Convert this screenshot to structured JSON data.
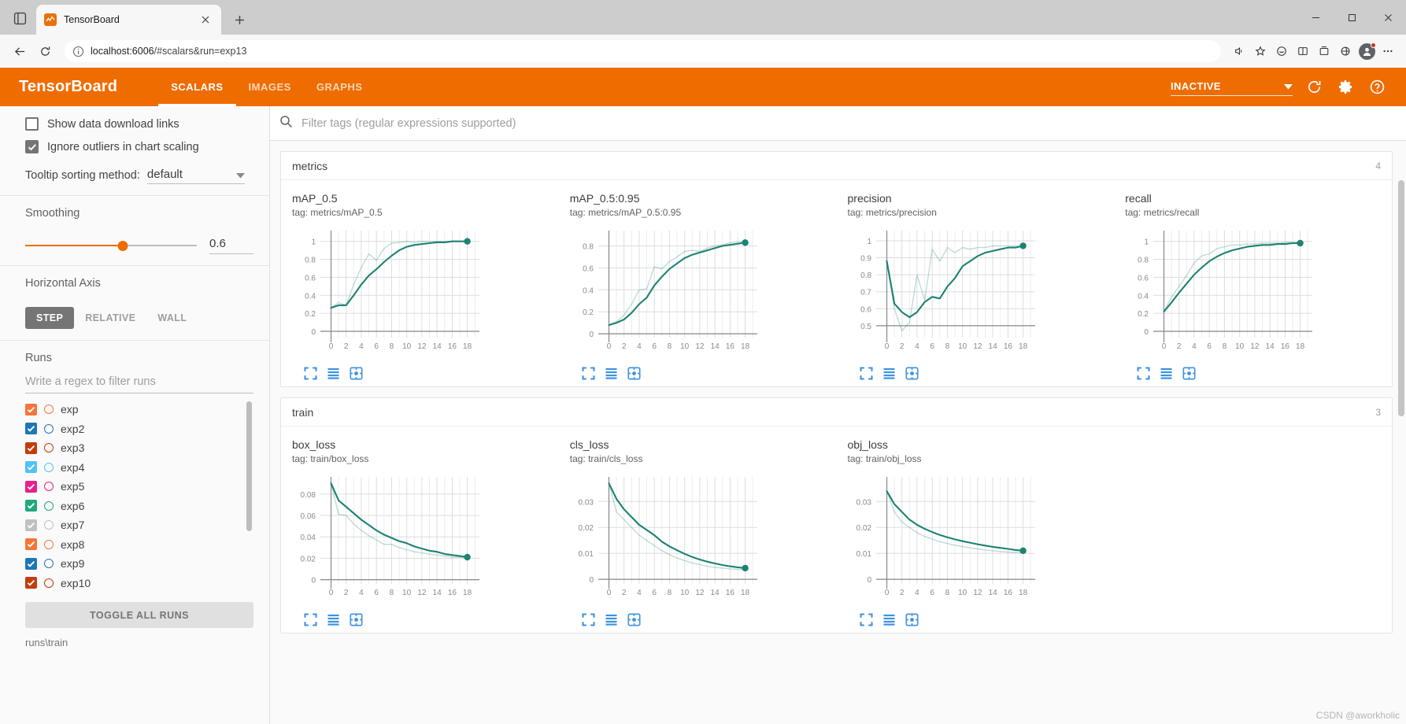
{
  "browser": {
    "tab": {
      "title": "TensorBoard",
      "favicon_icon": "tensorboard-favicon",
      "close_icon": "close-icon"
    },
    "tab_list_icon": "tab-list-icon",
    "new_tab_icon": "plus-icon",
    "window_controls": [
      {
        "name": "minimize-button",
        "icon": "minimize-icon"
      },
      {
        "name": "maximize-button",
        "icon": "maximize-icon"
      },
      {
        "name": "close-window-button",
        "icon": "close-icon"
      }
    ],
    "nav": {
      "back_icon": "back-arrow-icon",
      "reload_icon": "reload-icon",
      "info_icon": "info-circle-icon",
      "url_host": "localhost:6006",
      "url_path": "/#scalars&run=exp13",
      "read_aloud_icon": "read-aloud-icon",
      "favorite_icon": "star-icon",
      "copilot_icon": "copilot-icon",
      "split_icon": "split-screen-icon",
      "collections_icon": "collections-icon",
      "browser_essentials_icon": "browser-essentials-icon",
      "settings_icon": "more-options-icon",
      "profile_icon": "profile-avatar"
    }
  },
  "tensorboard": {
    "logo": "TensorBoard",
    "tabs": [
      {
        "label": "SCALARS",
        "active": true
      },
      {
        "label": "IMAGES",
        "active": false
      },
      {
        "label": "GRAPHS",
        "active": false
      }
    ],
    "status_select": {
      "value": "INACTIVE",
      "caret_icon": "chevron-down-icon"
    },
    "header_icons": [
      {
        "name": "reload-button",
        "icon": "reload-icon"
      },
      {
        "name": "settings-button",
        "icon": "gear-icon"
      },
      {
        "name": "help-button",
        "icon": "help-circle-icon"
      }
    ]
  },
  "sidebar": {
    "checkboxes": [
      {
        "label": "Show data download links",
        "checked": false,
        "name": "show-data-download-links-checkbox"
      },
      {
        "label": "Ignore outliers in chart scaling",
        "checked": true,
        "name": "ignore-outliers-checkbox"
      }
    ],
    "tooltip_sorting": {
      "label": "Tooltip sorting method:",
      "value": "default"
    },
    "smoothing": {
      "title": "Smoothing",
      "value": "0.6",
      "percent": 57
    },
    "horizontal_axis": {
      "title": "Horizontal Axis",
      "options": [
        {
          "label": "STEP",
          "active": true
        },
        {
          "label": "RELATIVE",
          "active": false
        },
        {
          "label": "WALL",
          "active": false
        }
      ]
    },
    "runs": {
      "title": "Runs",
      "filter_placeholder": "Write a regex to filter runs",
      "items": [
        {
          "label": "exp",
          "color": "#f4763b",
          "checked": true
        },
        {
          "label": "exp2",
          "color": "#1f77b4",
          "checked": true
        },
        {
          "label": "exp3",
          "color": "#c43c0c",
          "checked": true
        },
        {
          "label": "exp4",
          "color": "#4fc3f7",
          "checked": true
        },
        {
          "label": "exp5",
          "color": "#e91e8c",
          "checked": true
        },
        {
          "label": "exp6",
          "color": "#1fa97f",
          "checked": true
        },
        {
          "label": "exp7",
          "color": "#c0c0c0",
          "checked": true
        },
        {
          "label": "exp8",
          "color": "#f4763b",
          "checked": true
        },
        {
          "label": "exp9",
          "color": "#1f77b4",
          "checked": true
        },
        {
          "label": "exp10",
          "color": "#c43c0c",
          "checked": true
        }
      ],
      "toggle_all_label": "TOGGLE ALL RUNS",
      "path": "runs\\train"
    }
  },
  "main": {
    "filter_placeholder": "Filter tags (regular expressions supported)",
    "search_icon": "search-icon",
    "chart_tool_icons": [
      "fullscreen-icon",
      "data-table-icon",
      "reset-axis-icon"
    ],
    "groups": [
      {
        "title": "metrics",
        "count": "4"
      },
      {
        "title": "train",
        "count": "3"
      }
    ],
    "watermark": "CSDN @aworkholic"
  },
  "chart_data": [
    {
      "type": "line",
      "title": "mAP_0.5",
      "tag": "tag: metrics/mAP_0.5",
      "group": "metrics",
      "xlabel": "",
      "ylabel": "",
      "xticks": [
        0,
        2,
        4,
        6,
        8,
        10,
        12,
        14,
        16,
        18
      ],
      "yticks": [
        0,
        0.2,
        0.4,
        0.6,
        0.8,
        1
      ],
      "xlim": [
        -1.4,
        19.6
      ],
      "ylim": [
        -0.07,
        1.12
      ],
      "grid": true,
      "legend": "none",
      "x": [
        0,
        1,
        2,
        3,
        4,
        5,
        6,
        7,
        8,
        9,
        10,
        11,
        12,
        13,
        14,
        15,
        16,
        17,
        18
      ],
      "series": [
        {
          "name": "raw",
          "opacity": 0.28,
          "values": [
            0.26,
            0.32,
            0.29,
            0.52,
            0.71,
            0.86,
            0.79,
            0.92,
            0.98,
            0.99,
            1.0,
            0.99,
            1.0,
            1.0,
            1.0,
            1.0,
            1.0,
            1.0,
            1.0
          ]
        },
        {
          "name": "smoothed",
          "opacity": 1.0,
          "endpoint": true,
          "values": [
            0.26,
            0.29,
            0.29,
            0.4,
            0.52,
            0.62,
            0.69,
            0.77,
            0.84,
            0.9,
            0.94,
            0.96,
            0.97,
            0.98,
            0.99,
            0.99,
            1.0,
            1.0,
            1.0
          ]
        }
      ]
    },
    {
      "type": "line",
      "title": "mAP_0.5:0.95",
      "tag": "tag: metrics/mAP_0.5:0.95",
      "group": "metrics",
      "xlabel": "",
      "ylabel": "",
      "xticks": [
        0,
        2,
        4,
        6,
        8,
        10,
        12,
        14,
        16,
        18
      ],
      "yticks": [
        0,
        0.2,
        0.4,
        0.6,
        0.8
      ],
      "xlim": [
        -1.4,
        19.6
      ],
      "ylim": [
        -0.035,
        0.94
      ],
      "grid": true,
      "legend": "none",
      "x": [
        0,
        1,
        2,
        3,
        4,
        5,
        6,
        7,
        8,
        9,
        10,
        11,
        12,
        13,
        14,
        15,
        16,
        17,
        18
      ],
      "series": [
        {
          "name": "raw",
          "opacity": 0.28,
          "values": [
            0.08,
            0.11,
            0.17,
            0.27,
            0.4,
            0.41,
            0.61,
            0.59,
            0.66,
            0.7,
            0.75,
            0.76,
            0.75,
            0.78,
            0.8,
            0.81,
            0.83,
            0.84,
            0.84
          ]
        },
        {
          "name": "smoothed",
          "opacity": 1.0,
          "endpoint": true,
          "values": [
            0.08,
            0.1,
            0.13,
            0.19,
            0.27,
            0.33,
            0.44,
            0.52,
            0.59,
            0.64,
            0.69,
            0.72,
            0.74,
            0.76,
            0.78,
            0.8,
            0.81,
            0.82,
            0.83
          ]
        }
      ]
    },
    {
      "type": "line",
      "title": "precision",
      "tag": "tag: metrics/precision",
      "group": "metrics",
      "xlabel": "",
      "ylabel": "",
      "xticks": [
        0,
        2,
        4,
        6,
        8,
        10,
        12,
        14,
        16,
        18
      ],
      "yticks": [
        0.5,
        0.6,
        0.7,
        0.8,
        0.9,
        1
      ],
      "xlim": [
        -1.4,
        19.6
      ],
      "ylim": [
        0.43,
        1.06
      ],
      "grid": true,
      "legend": "none",
      "x": [
        0,
        1,
        2,
        3,
        4,
        5,
        6,
        7,
        8,
        9,
        10,
        11,
        12,
        13,
        14,
        15,
        16,
        17,
        18
      ],
      "series": [
        {
          "name": "raw",
          "opacity": 0.28,
          "values": [
            0.88,
            0.6,
            0.47,
            0.52,
            0.8,
            0.65,
            0.95,
            0.88,
            0.96,
            0.93,
            0.96,
            0.95,
            0.96,
            0.96,
            0.97,
            0.97,
            0.97,
            0.97,
            0.97
          ]
        },
        {
          "name": "smoothed",
          "opacity": 1.0,
          "endpoint": true,
          "values": [
            0.88,
            0.63,
            0.58,
            0.55,
            0.58,
            0.64,
            0.67,
            0.66,
            0.73,
            0.78,
            0.85,
            0.88,
            0.91,
            0.93,
            0.94,
            0.95,
            0.96,
            0.96,
            0.97
          ]
        }
      ]
    },
    {
      "type": "line",
      "title": "recall",
      "tag": "tag: metrics/recall",
      "group": "metrics",
      "xlabel": "",
      "ylabel": "",
      "xticks": [
        0,
        2,
        4,
        6,
        8,
        10,
        12,
        14,
        16,
        18
      ],
      "yticks": [
        0,
        0.2,
        0.4,
        0.6,
        0.8,
        1
      ],
      "xlim": [
        -1.4,
        19.6
      ],
      "ylim": [
        -0.07,
        1.12
      ],
      "grid": true,
      "legend": "none",
      "x": [
        0,
        1,
        2,
        3,
        4,
        5,
        6,
        7,
        8,
        9,
        10,
        11,
        12,
        13,
        14,
        15,
        16,
        17,
        18
      ],
      "series": [
        {
          "name": "raw",
          "opacity": 0.28,
          "values": [
            0.22,
            0.38,
            0.5,
            0.62,
            0.76,
            0.84,
            0.86,
            0.92,
            0.94,
            0.96,
            0.96,
            0.97,
            0.97,
            0.98,
            0.98,
            0.98,
            0.99,
            0.99,
            0.99
          ]
        },
        {
          "name": "smoothed",
          "opacity": 1.0,
          "endpoint": true,
          "values": [
            0.22,
            0.32,
            0.43,
            0.53,
            0.63,
            0.71,
            0.78,
            0.83,
            0.87,
            0.9,
            0.92,
            0.94,
            0.95,
            0.96,
            0.96,
            0.97,
            0.97,
            0.98,
            0.98
          ]
        }
      ]
    },
    {
      "type": "line",
      "title": "box_loss",
      "tag": "tag: train/box_loss",
      "group": "train",
      "xlabel": "",
      "ylabel": "",
      "xticks": [
        0,
        2,
        4,
        6,
        8,
        10,
        12,
        14,
        16,
        18
      ],
      "yticks": [
        0,
        0.02,
        0.04,
        0.06,
        0.08
      ],
      "xlim": [
        -1.4,
        19.6
      ],
      "ylim": [
        -0.004,
        0.096
      ],
      "grid": true,
      "legend": "none",
      "x": [
        0,
        1,
        2,
        3,
        4,
        5,
        6,
        7,
        8,
        9,
        10,
        11,
        12,
        13,
        14,
        15,
        16,
        17,
        18
      ],
      "series": [
        {
          "name": "raw",
          "opacity": 0.28,
          "values": [
            0.09,
            0.061,
            0.06,
            0.052,
            0.046,
            0.041,
            0.037,
            0.033,
            0.033,
            0.03,
            0.028,
            0.026,
            0.025,
            0.024,
            0.023,
            0.022,
            0.021,
            0.021,
            0.02
          ]
        },
        {
          "name": "smoothed",
          "opacity": 1.0,
          "endpoint": true,
          "values": [
            0.09,
            0.074,
            0.068,
            0.062,
            0.056,
            0.051,
            0.046,
            0.042,
            0.039,
            0.036,
            0.034,
            0.031,
            0.029,
            0.027,
            0.026,
            0.024,
            0.023,
            0.022,
            0.021
          ]
        }
      ]
    },
    {
      "type": "line",
      "title": "cls_loss",
      "tag": "tag: train/cls_loss",
      "group": "train",
      "xlabel": "",
      "ylabel": "",
      "xticks": [
        0,
        2,
        4,
        6,
        8,
        10,
        12,
        14,
        16,
        18
      ],
      "yticks": [
        0,
        0.01,
        0.02,
        0.03
      ],
      "xlim": [
        -1.4,
        19.6
      ],
      "ylim": [
        -0.0018,
        0.0395
      ],
      "grid": true,
      "legend": "none",
      "x": [
        0,
        1,
        2,
        3,
        4,
        5,
        6,
        7,
        8,
        9,
        10,
        11,
        12,
        13,
        14,
        15,
        16,
        17,
        18
      ],
      "series": [
        {
          "name": "raw",
          "opacity": 0.28,
          "values": [
            0.037,
            0.026,
            0.023,
            0.02,
            0.017,
            0.015,
            0.013,
            0.011,
            0.0095,
            0.0082,
            0.0072,
            0.0063,
            0.0056,
            0.005,
            0.0046,
            0.0043,
            0.004,
            0.0038,
            0.0036
          ]
        },
        {
          "name": "smoothed",
          "opacity": 1.0,
          "endpoint": true,
          "values": [
            0.037,
            0.031,
            0.027,
            0.024,
            0.021,
            0.019,
            0.017,
            0.0145,
            0.0127,
            0.0112,
            0.0098,
            0.0086,
            0.0076,
            0.0068,
            0.0061,
            0.0055,
            0.005,
            0.0046,
            0.0043
          ]
        }
      ]
    },
    {
      "type": "line",
      "title": "obj_loss",
      "tag": "tag: train/obj_loss",
      "group": "train",
      "xlabel": "",
      "ylabel": "",
      "xticks": [
        0,
        2,
        4,
        6,
        8,
        10,
        12,
        14,
        16,
        18
      ],
      "yticks": [
        0,
        0.01,
        0.02,
        0.03
      ],
      "xlim": [
        -1.4,
        19.6
      ],
      "ylim": [
        -0.0018,
        0.0395
      ],
      "grid": true,
      "legend": "none",
      "x": [
        0,
        1,
        2,
        3,
        4,
        5,
        6,
        7,
        8,
        9,
        10,
        11,
        12,
        13,
        14,
        15,
        16,
        17,
        18
      ],
      "series": [
        {
          "name": "raw",
          "opacity": 0.28,
          "values": [
            0.034,
            0.026,
            0.022,
            0.02,
            0.018,
            0.0165,
            0.0155,
            0.0145,
            0.0138,
            0.0131,
            0.0126,
            0.0121,
            0.0117,
            0.0113,
            0.011,
            0.0107,
            0.0105,
            0.0103,
            0.0101
          ]
        },
        {
          "name": "smoothed",
          "opacity": 1.0,
          "endpoint": true,
          "values": [
            0.034,
            0.029,
            0.026,
            0.023,
            0.021,
            0.0195,
            0.0182,
            0.0171,
            0.0162,
            0.0154,
            0.0147,
            0.0141,
            0.0135,
            0.013,
            0.0125,
            0.0121,
            0.0117,
            0.0113,
            0.011
          ]
        }
      ]
    }
  ],
  "chart_style": {
    "line_color": "#1d8272",
    "grid_color": "#dddddd",
    "axis_color": "#888888",
    "tick_label_color": "#8a8a8a"
  }
}
